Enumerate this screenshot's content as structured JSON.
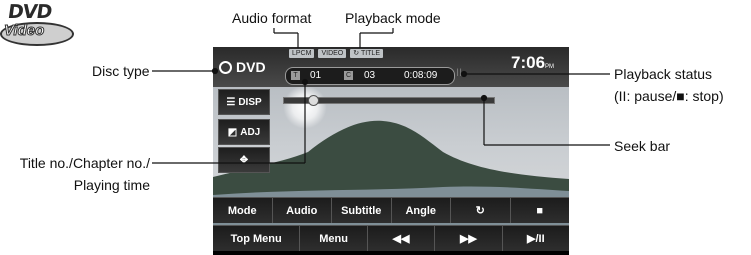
{
  "logo": {
    "line1": "DVD",
    "line2": "Video"
  },
  "callouts": {
    "audio_format": "Audio format",
    "playback_mode": "Playback mode",
    "disc_type": "Disc type",
    "playback_status": "Playback status",
    "playback_status_note": "(II: pause/■: stop)",
    "seek_bar": "Seek bar",
    "title_chapter_line1": "Title no./Chapter no./",
    "title_chapter_line2": "Playing time"
  },
  "screen": {
    "disc_type": "DVD",
    "format_tags": [
      "LPCM",
      "VIDEO",
      "TITLE"
    ],
    "title_icon": "T",
    "title_no": "01",
    "chapter_icon": "C",
    "chapter_no": "03",
    "playing_time": "0:08:09",
    "status_glyph": "II",
    "clock": "7:06",
    "clock_suffix": "PM",
    "seek_progress": 0.12,
    "side_buttons": [
      {
        "label": "DISP",
        "icon": "list-icon"
      },
      {
        "label": "ADJ",
        "icon": "adjust-icon"
      },
      {
        "label": "",
        "icon": "move-arrows-icon"
      }
    ],
    "row1": [
      "Mode",
      "Audio",
      "Subtitle",
      "Angle",
      "↻",
      "■"
    ],
    "row2": [
      "Top Menu",
      "Menu",
      "◀◀",
      "▶▶",
      "▶/II"
    ]
  }
}
